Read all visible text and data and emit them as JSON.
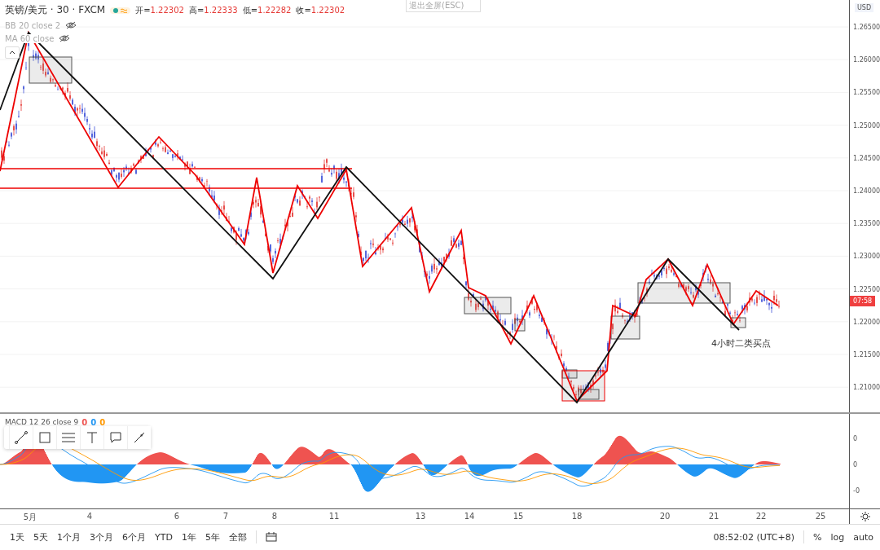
{
  "symbol": {
    "title": "英镑/美元 · 30 · FXCM"
  },
  "ohlc": [
    {
      "label": "开=",
      "value": "1.22302"
    },
    {
      "label": "高=",
      "value": "1.22333"
    },
    {
      "label": "低=",
      "value": "1.22282"
    },
    {
      "label": "收=",
      "value": "1.22302"
    }
  ],
  "indicators": [
    {
      "label": "BB 20 close 2",
      "visible": false
    },
    {
      "label": "MA 60 close",
      "visible": false
    }
  ],
  "exit_fullscreen": "退出全屏(ESC)",
  "price_axis": {
    "currency": "USD",
    "ticks": [
      "1.26500",
      "1.26000",
      "1.25500",
      "1.25000",
      "1.24500",
      "1.24000",
      "1.23500",
      "1.23000",
      "1.22500",
      "1.22000",
      "1.21500",
      "1.21000"
    ],
    "countdown": "07:58"
  },
  "annotation": "4小时二类买点",
  "macd": {
    "label": "MACD 12 26 close 9",
    "values": [
      {
        "text": "0",
        "color": "#ef5350"
      },
      {
        "text": "0",
        "color": "#2196f3"
      },
      {
        "text": "0",
        "color": "#ff9800"
      }
    ],
    "ticks": [
      "0",
      "0",
      "-0"
    ]
  },
  "time_axis": [
    "5月",
    "4",
    "6",
    "7",
    "8",
    "11",
    "13",
    "14",
    "15",
    "18",
    "20",
    "21",
    "22",
    "25"
  ],
  "ranges": [
    "1天",
    "5天",
    "1个月",
    "3个月",
    "6个月",
    "YTD",
    "1年",
    "5年",
    "全部"
  ],
  "clock": "08:52:02 (UTC+8)",
  "scale_options": [
    "%",
    "log",
    "auto"
  ]
}
